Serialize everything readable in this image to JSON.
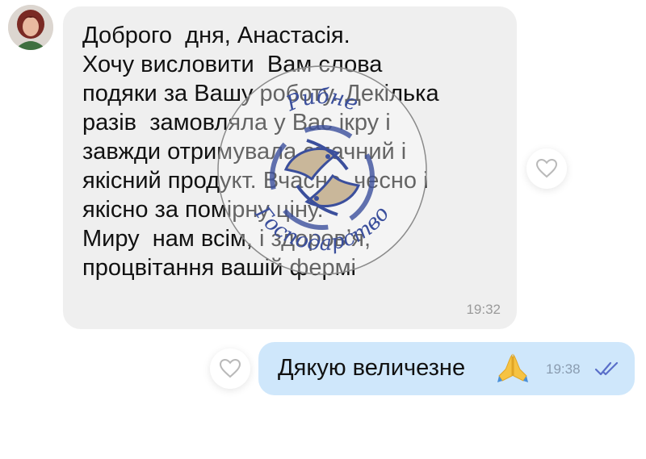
{
  "incoming": {
    "lines": [
      "Доброго  дня, Анастасія.",
      "Хочу висловити  Вам слова",
      "подяки за Вашу роботу. Декілька",
      "разів  замовляла у Вас ікру і",
      "завжди отримувала смачний і",
      "якісний продукт. Вчасно, чесно і",
      "якісно за помірну ціну.",
      "Миру  нам всім, і здоровʼя,",
      "процвітання вашій фермі"
    ],
    "time": "19:32"
  },
  "outgoing": {
    "text": "Дякую величезне",
    "emoji": "praying-hands",
    "time": "19:38",
    "status": "read"
  },
  "watermark": {
    "top_text": "Рибне",
    "bottom_text": "Господарство"
  },
  "colors": {
    "incoming_bubble": "#efefef",
    "outgoing_bubble": "#cfe7fb",
    "read_ticks": "#5a6fc9",
    "stamp": "#3b4f9c",
    "stamp_fill": "#c9b79a"
  }
}
